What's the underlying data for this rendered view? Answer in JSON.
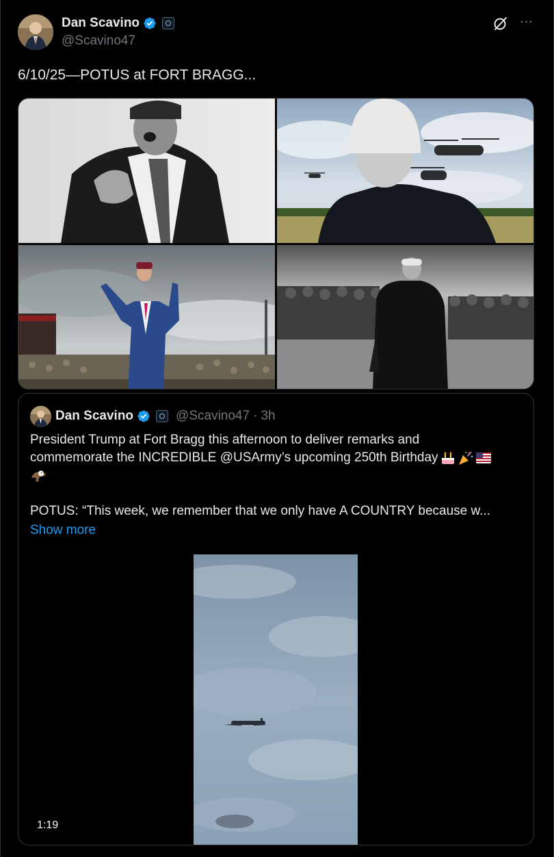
{
  "post": {
    "author_name": "Dan Scavino",
    "author_handle": "@Scavino47",
    "text": "6/10/25—POTUS at FORT BRAGG..."
  },
  "quoted_post": {
    "author_name": "Dan Scavino",
    "author_handle": "@Scavino47",
    "separator": "·",
    "timestamp": "3h",
    "line1": "President Trump at Fort Bragg this afternoon to deliver remarks and",
    "line2": "commemorate the INCREDIBLE @USArmy’s upcoming 250th Birthday",
    "line4": "POTUS: “This week, we remember that we only have A COUNTRY because w...",
    "show_more": "Show more",
    "emojis": [
      "birthday-cake",
      "party-popper",
      "us-flag",
      "eagle"
    ],
    "video_duration": "1:19"
  },
  "icons": {
    "verified": "verified-badge-icon",
    "affiliation": "government-affiliation-icon",
    "grok": "grok-icon",
    "more": "more-icon"
  },
  "colors": {
    "background": "#000000",
    "text": "#e7e9ea",
    "secondary_text": "#71767b",
    "link": "#1d9bf0",
    "verified": "#1d9bf0",
    "border": "#2f3336"
  }
}
